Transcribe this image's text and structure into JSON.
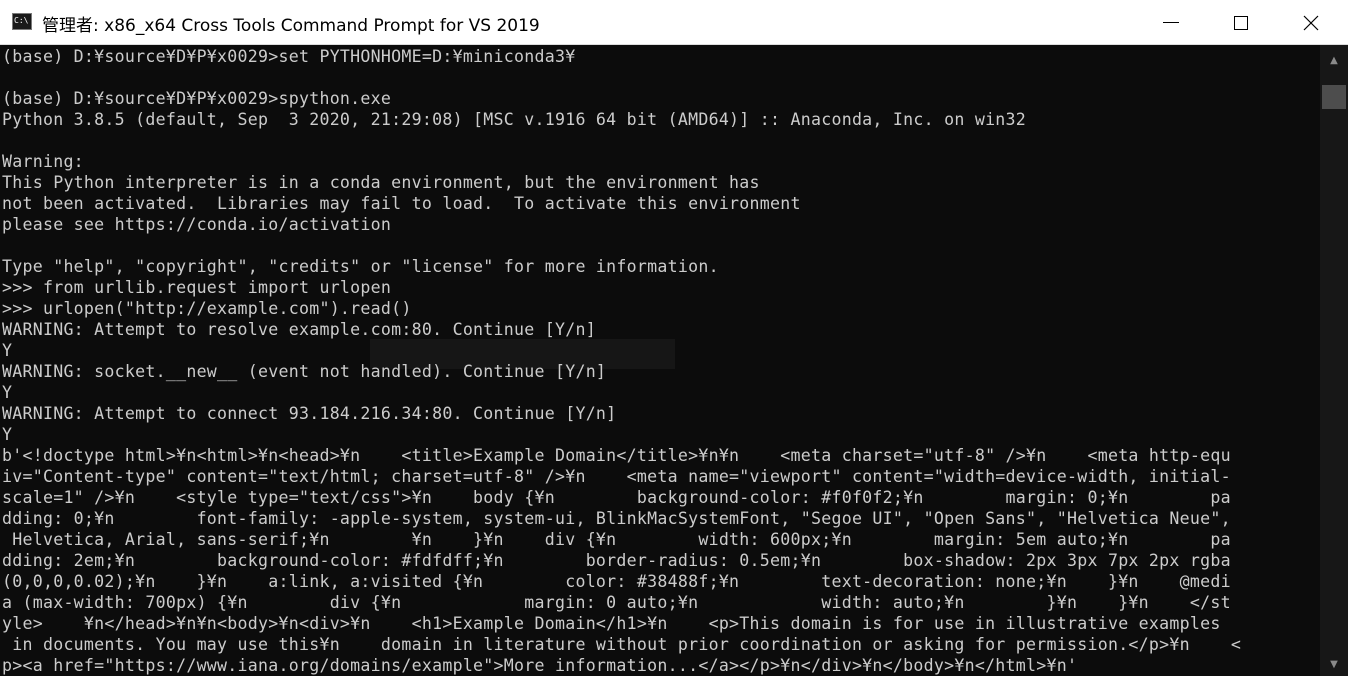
{
  "window": {
    "title": "管理者: x86_x64 Cross Tools Command Prompt for VS 2019",
    "icon": "console-icon",
    "icon_text": "C:\\"
  },
  "caption_buttons": {
    "minimize_icon": "minimize-icon",
    "maximize_icon": "maximize-icon",
    "close_glyph": "✕"
  },
  "console": {
    "background": "#0c0c0c",
    "foreground": "#cccccc",
    "lines": [
      "(base) D:¥source¥D¥P¥x0029>set PYTHONHOME=D:¥miniconda3¥",
      "",
      "(base) D:¥source¥D¥P¥x0029>spython.exe",
      "Python 3.8.5 (default, Sep  3 2020, 21:29:08) [MSC v.1916 64 bit (AMD64)] :: Anaconda, Inc. on win32",
      "",
      "Warning:",
      "This Python interpreter is in a conda environment, but the environment has",
      "not been activated.  Libraries may fail to load.  To activate this environment",
      "please see https://conda.io/activation",
      "",
      "Type \"help\", \"copyright\", \"credits\" or \"license\" for more information.",
      ">>> from urllib.request import urlopen",
      ">>> urlopen(\"http://example.com\").read()",
      "WARNING: Attempt to resolve example.com:80. Continue [Y/n]",
      "Y",
      "WARNING: socket.__new__ (event not handled). Continue [Y/n]",
      "Y",
      "WARNING: Attempt to connect 93.184.216.34:80. Continue [Y/n]",
      "Y",
      "b'<!doctype html>¥n<html>¥n<head>¥n    <title>Example Domain</title>¥n¥n    <meta charset=\"utf-8\" />¥n    <meta http-equ",
      "iv=\"Content-type\" content=\"text/html; charset=utf-8\" />¥n    <meta name=\"viewport\" content=\"width=device-width, initial-",
      "scale=1\" />¥n    <style type=\"text/css\">¥n    body {¥n        background-color: #f0f0f2;¥n        margin: 0;¥n        pa",
      "dding: 0;¥n        font-family: -apple-system, system-ui, BlinkMacSystemFont, \"Segoe UI\", \"Open Sans\", \"Helvetica Neue\",",
      " Helvetica, Arial, sans-serif;¥n        ¥n    }¥n    div {¥n        width: 600px;¥n        margin: 5em auto;¥n        pa",
      "dding: 2em;¥n        background-color: #fdfdff;¥n        border-radius: 0.5em;¥n        box-shadow: 2px 3px 7px 2px rgba",
      "(0,0,0,0.02);¥n    }¥n    a:link, a:visited {¥n        color: #38488f;¥n        text-decoration: none;¥n    }¥n    @medi",
      "a (max-width: 700px) {¥n        div {¥n            margin: 0 auto;¥n            width: auto;¥n        }¥n    }¥n    </st",
      "yle>    ¥n</head>¥n¥n<body>¥n<div>¥n    <h1>Example Domain</h1>¥n    <p>This domain is for use in illustrative examples",
      " in documents. You may use this¥n    domain in literature without prior coordination or asking for permission.</p>¥n    <",
      "p><a href=\"https://www.iana.org/domains/example\">More information...</a></p>¥n</div>¥n</body>¥n</html>¥n'"
    ]
  },
  "scrollbar": {
    "up_glyph": "▲",
    "down_glyph": "▼"
  }
}
